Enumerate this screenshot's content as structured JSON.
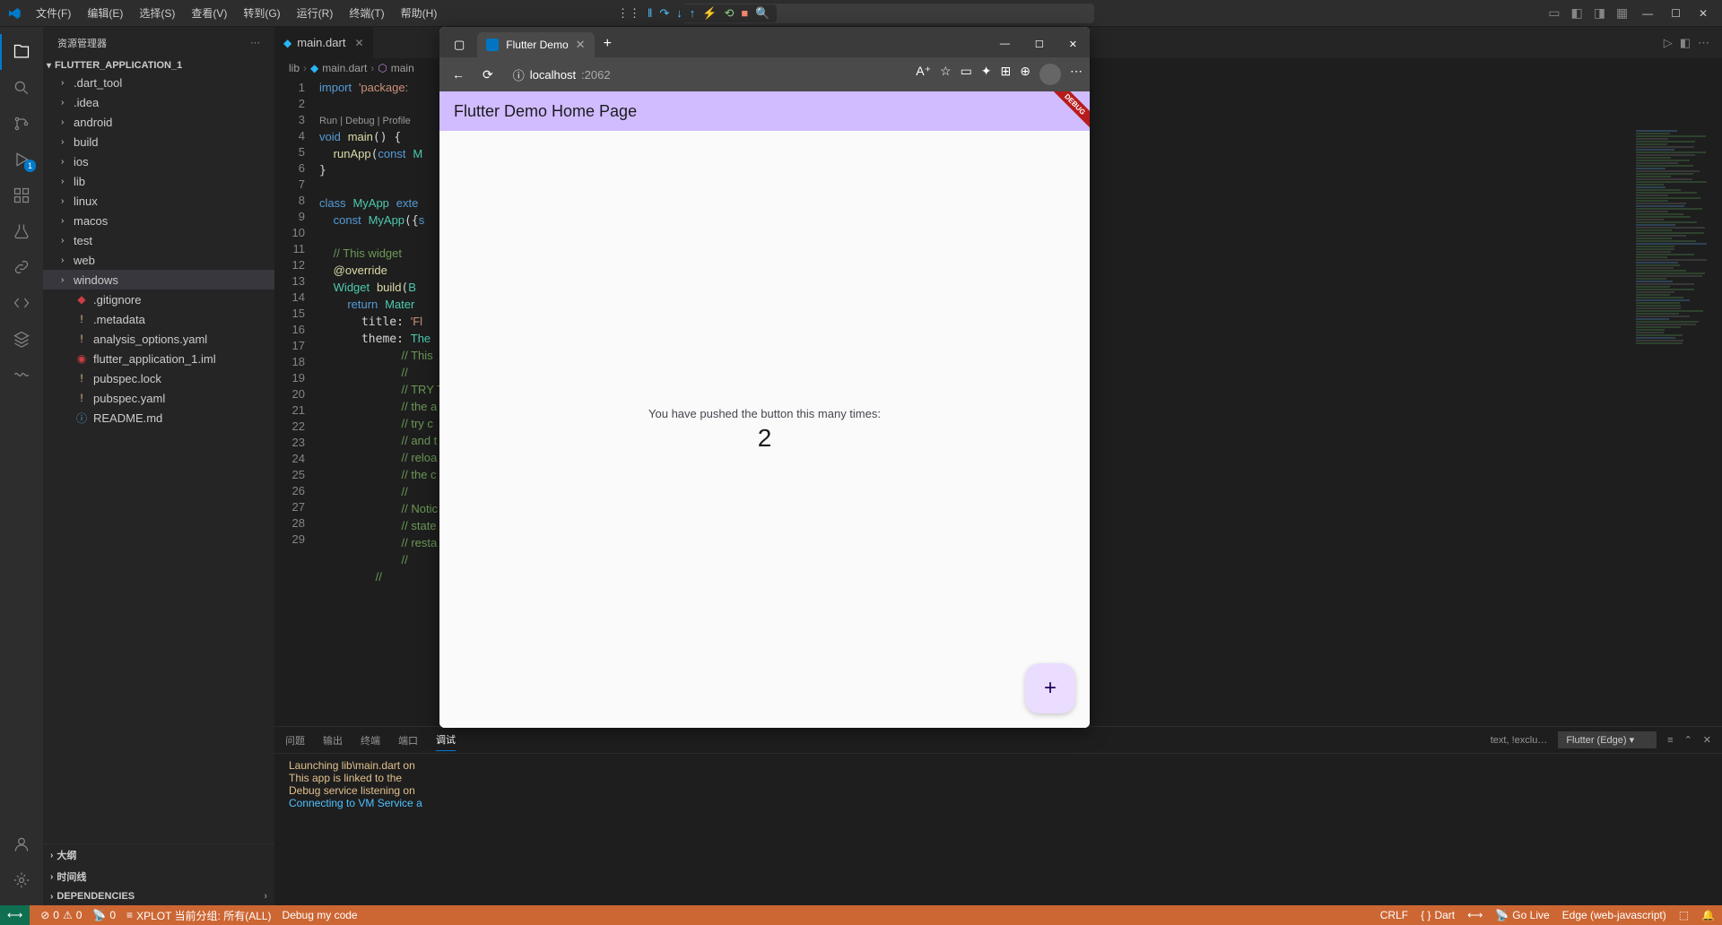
{
  "menu": {
    "file": "文件(F)",
    "edit": "编辑(E)",
    "select": "选择(S)",
    "view": "查看(V)",
    "goto": "转到(G)",
    "run": "运行(R)",
    "terminal": "终端(T)",
    "help": "帮助(H)"
  },
  "sidebar": {
    "header": "资源管理器",
    "project": "FLUTTER_APPLICATION_1",
    "items": [
      {
        "name": ".dart_tool",
        "type": "folder"
      },
      {
        "name": ".idea",
        "type": "folder"
      },
      {
        "name": "android",
        "type": "folder"
      },
      {
        "name": "build",
        "type": "folder"
      },
      {
        "name": "ios",
        "type": "folder"
      },
      {
        "name": "lib",
        "type": "folder"
      },
      {
        "name": "linux",
        "type": "folder"
      },
      {
        "name": "macos",
        "type": "folder"
      },
      {
        "name": "test",
        "type": "folder"
      },
      {
        "name": "web",
        "type": "folder"
      },
      {
        "name": "windows",
        "type": "folder",
        "selected": true
      },
      {
        "name": ".gitignore",
        "type": "file"
      },
      {
        "name": ".metadata",
        "type": "file"
      },
      {
        "name": "analysis_options.yaml",
        "type": "file"
      },
      {
        "name": "flutter_application_1.iml",
        "type": "file"
      },
      {
        "name": "pubspec.lock",
        "type": "file"
      },
      {
        "name": "pubspec.yaml",
        "type": "file"
      },
      {
        "name": "README.md",
        "type": "file"
      }
    ],
    "sections": {
      "outline": "大纲",
      "timeline": "时间线",
      "dependencies": "DEPENDENCIES"
    }
  },
  "activity_badge": "1",
  "tab": {
    "name": "main.dart"
  },
  "breadcrumb": {
    "p1": "lib",
    "p2": "main.dart",
    "p3": "main"
  },
  "codelens": "Run | Debug | Profile",
  "code_lines": [
    "import 'package:",
    "",
    "",
    "void main() {",
    "  runApp(const M",
    "}",
    "",
    "class MyApp exte",
    "  const MyApp({s",
    "",
    "  // This widget",
    "  @override",
    "  Widget build(B",
    "    return Mater",
    "      title: 'Fl",
    "      theme: The",
    "        // This ",
    "        //",
    "        // TRY T",
    "        // the a",
    "        // try c",
    "        // and t",
    "        // reloa",
    "        // the c",
    "        //",
    "        // Notic",
    "        // state",
    "        // resta",
    "        //",
    ""
  ],
  "panel": {
    "tabs": {
      "problems": "问题",
      "output": "输出",
      "terminal": "终端",
      "ports": "端口",
      "debug": "调试"
    },
    "filter": "text, !exclu…",
    "dropdown": "Flutter (Edge)",
    "lines": [
      "Launching lib\\main.dart on",
      "This app is linked to the",
      "Debug service listening on",
      "Connecting to VM Service a"
    ]
  },
  "status": {
    "errors": "0",
    "warnings": "0",
    "port": "0",
    "xplot": "XPLOT 当前分组: 所有(ALL)",
    "debug": "Debug my code",
    "crlf": "CRLF",
    "lang": "Dart",
    "golive": "Go Live",
    "target": "Edge (web-javascript)"
  },
  "browser": {
    "tab_title": "Flutter Demo",
    "url_host": "localhost",
    "url_port": ":2062",
    "app_title": "Flutter Demo Home Page",
    "body_text": "You have pushed the button this many times:",
    "count": "2"
  }
}
